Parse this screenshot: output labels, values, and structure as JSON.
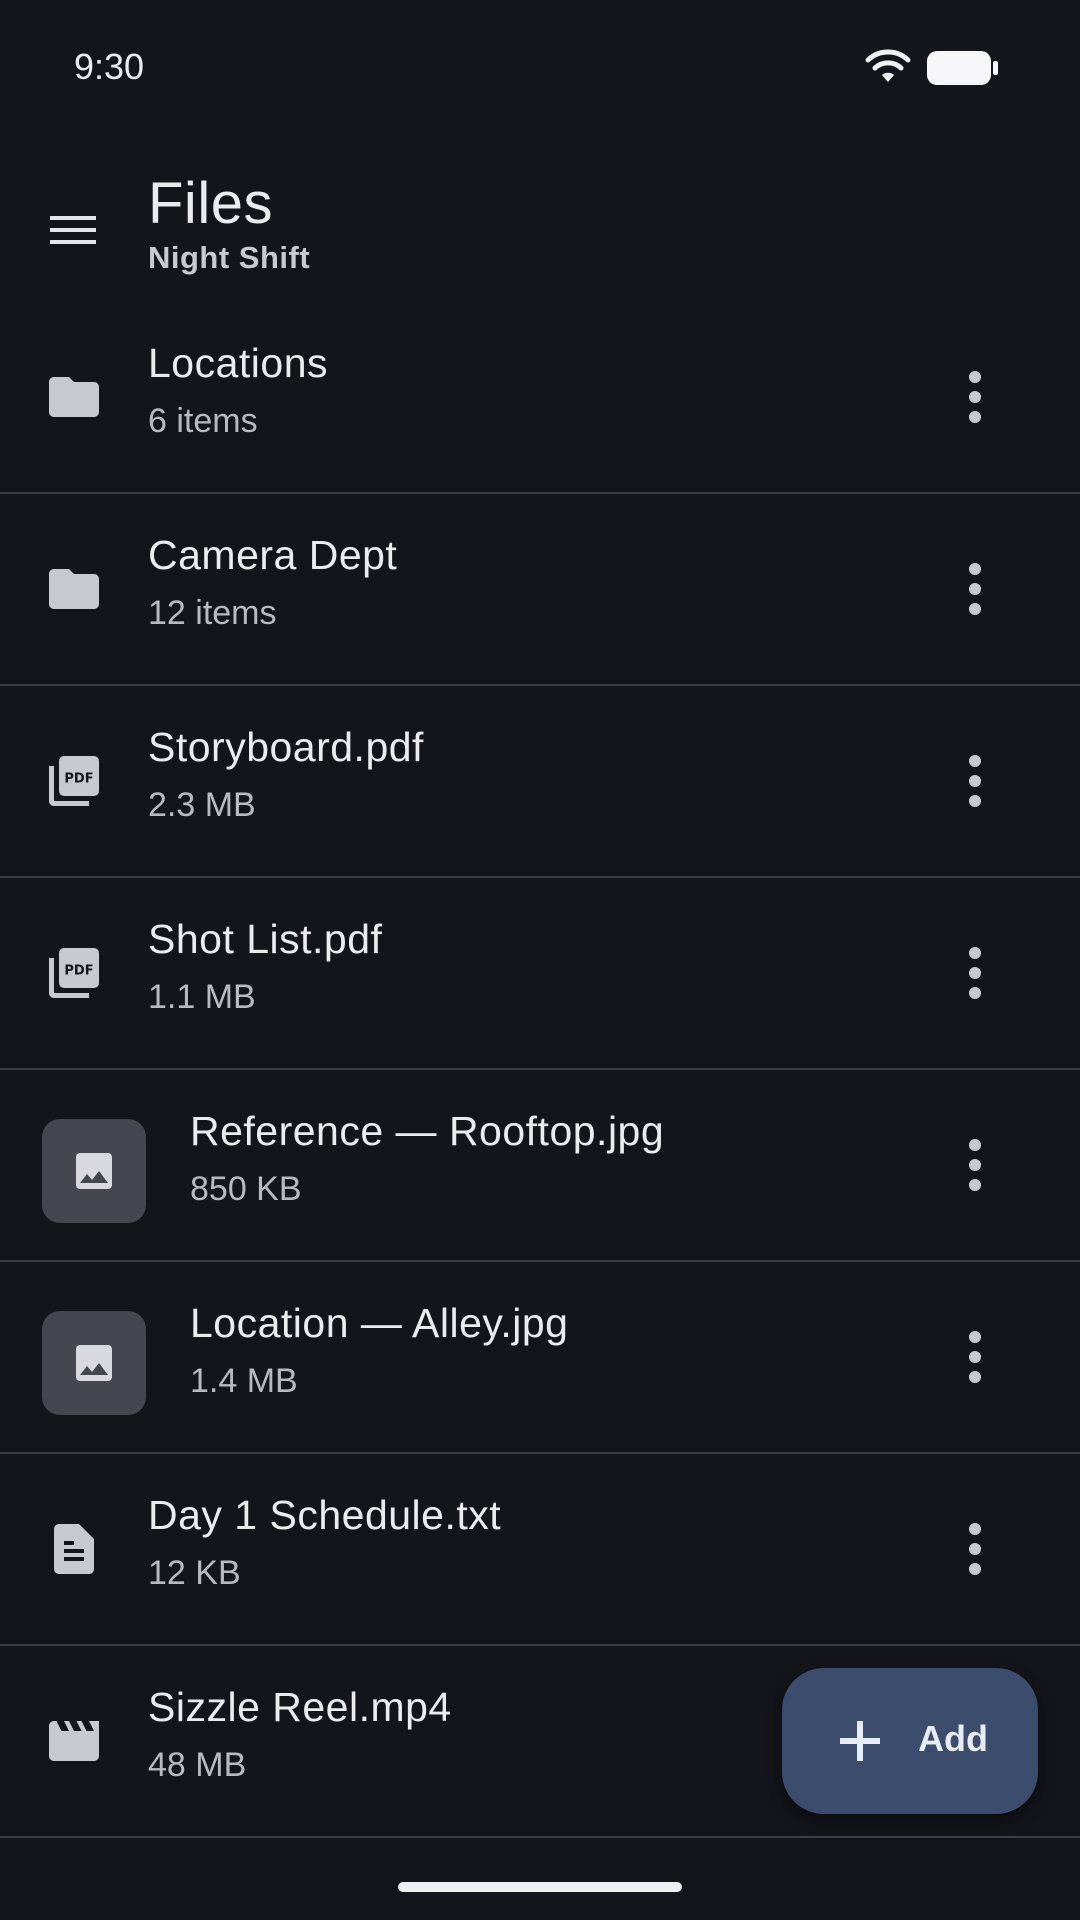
{
  "status_bar": {
    "time": "9:30",
    "wifi_icon": "wifi-icon",
    "battery_icon": "battery-icon"
  },
  "header": {
    "menu_icon": "menu-icon",
    "title": "Files",
    "subtitle": "Night Shift"
  },
  "files": [
    {
      "name": "Locations",
      "meta": "6 items",
      "icon": "folder-icon"
    },
    {
      "name": "Camera Dept",
      "meta": "12 items",
      "icon": "folder-icon"
    },
    {
      "name": "Storyboard.pdf",
      "meta": "2.3 MB",
      "icon": "pdf-icon"
    },
    {
      "name": "Shot List.pdf",
      "meta": "1.1 MB",
      "icon": "pdf-icon"
    },
    {
      "name": "Reference — Rooftop.jpg",
      "meta": "850 KB",
      "icon": "image-icon"
    },
    {
      "name": "Location — Alley.jpg",
      "meta": "1.4 MB",
      "icon": "image-icon"
    },
    {
      "name": "Day 1 Schedule.txt",
      "meta": "12 KB",
      "icon": "document-icon"
    },
    {
      "name": "Sizzle Reel.mp4",
      "meta": "48 MB",
      "icon": "video-clapper-icon"
    }
  ],
  "fab": {
    "label": "Add",
    "icon": "plus-icon"
  },
  "colors": {
    "background": "#14151a",
    "fab": "#3c4c6c",
    "divider": "#3b3d44",
    "thumb": "#44474f"
  }
}
